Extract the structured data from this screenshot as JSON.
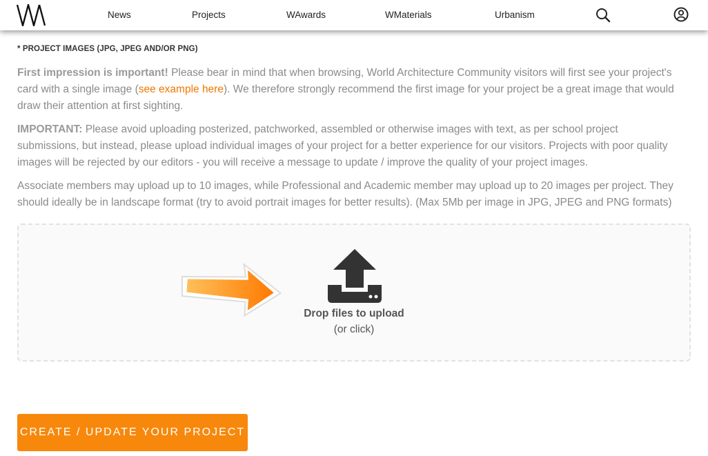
{
  "nav": {
    "logo": "W",
    "items": [
      {
        "label": "News"
      },
      {
        "label": "Projects"
      },
      {
        "label": "WAwards"
      },
      {
        "label": "WMaterials"
      },
      {
        "label": "Urbanism"
      }
    ],
    "search_icon": "search-icon",
    "account_icon": "user-circle-icon"
  },
  "section": {
    "label": "* PROJECT IMAGES (JPG, JPEG AND/OR PNG)"
  },
  "paragraphs": {
    "first": {
      "lead": "First impression is important!",
      "text1": " Please bear in mind that when browsing, World Architecture Community visitors will first see your project's card with a single image (",
      "link": "see example here",
      "text2": "). We therefore strongly recommend the first image for your project be a great image that would draw their attention at first sighting."
    },
    "second": {
      "lead": "IMPORTANT:",
      "text": " Please avoid uploading posterized, patchworked, assembled or otherwise images with text, as per school project submissions, but instead, please upload individual images of your project for a better experience for our visitors. Projects with poor quality images will be rejected by our editors - you will receive a message to update / improve the quality of your project images."
    },
    "third": {
      "text": "Associate members may upload up to 10 images, while Professional and Academic member may upload up to 20 images per project. They should ideally be in landscape format (try to avoid portrait images for better results). (Max 5Mb per image in JPG, JPEG and PNG formats)"
    }
  },
  "dropzone": {
    "title": "Drop files to upload",
    "subtitle": "(or click)",
    "icon": "upload-icon",
    "arrow": "orange-arrow-icon"
  },
  "submit": {
    "label": "CREATE / UPDATE YOUR PROJECT"
  },
  "colors": {
    "accent": "#f7880c",
    "link": "#f07800",
    "icon_dark": "#333333"
  }
}
